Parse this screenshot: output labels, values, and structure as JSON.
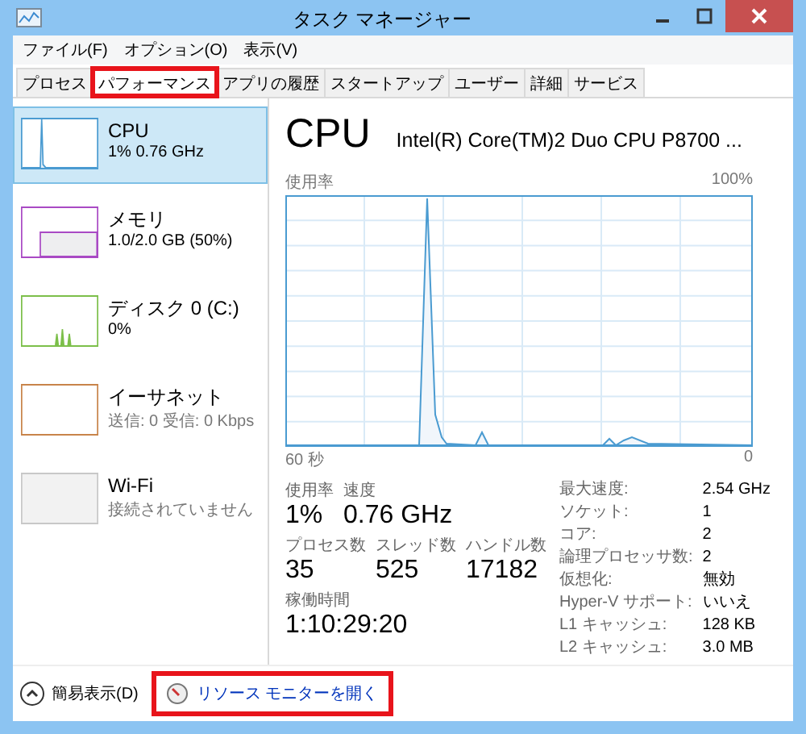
{
  "window": {
    "title": "タスク マネージャー"
  },
  "menu": [
    "ファイル(F)",
    "オプション(O)",
    "表示(V)"
  ],
  "tabs": [
    {
      "label": "プロセス",
      "selected": false,
      "highlighted": false
    },
    {
      "label": "パフォーマンス",
      "selected": true,
      "highlighted": true
    },
    {
      "label": "アプリの履歴",
      "selected": false,
      "highlighted": false
    },
    {
      "label": "スタートアップ",
      "selected": false,
      "highlighted": false
    },
    {
      "label": "ユーザー",
      "selected": false,
      "highlighted": false
    },
    {
      "label": "詳細",
      "selected": false,
      "highlighted": false
    },
    {
      "label": "サービス",
      "selected": false,
      "highlighted": false
    }
  ],
  "resources": [
    {
      "kind": "cpu",
      "name": "CPU",
      "detail": "1% 0.76 GHz",
      "selected": true,
      "color": "#4a9bd1"
    },
    {
      "kind": "memory",
      "name": "メモリ",
      "detail": "1.0/2.0 GB (50%)",
      "selected": false,
      "color": "#a94ac4"
    },
    {
      "kind": "disk",
      "name": "ディスク 0 (C:)",
      "detail": "0%",
      "selected": false,
      "color": "#7cbf4a"
    },
    {
      "kind": "ethernet",
      "name": "イーサネット",
      "detail": "送信: 0 受信: 0 Kbps",
      "selected": false,
      "color": "#c8844a"
    },
    {
      "kind": "wifi",
      "name": "Wi-Fi",
      "detail": "接続されていません",
      "selected": false,
      "color": "#c8c8c8"
    }
  ],
  "detail": {
    "title": "CPU",
    "model": "Intel(R) Core(TM)2 Duo CPU P8700 ...",
    "y_label": "使用率",
    "y_max": "100%",
    "x_start": "60 秒",
    "x_end": "0",
    "stats": [
      {
        "label": "使用率",
        "value": "1%"
      },
      {
        "label": "速度",
        "value": "0.76 GHz"
      }
    ],
    "counts": [
      {
        "label": "プロセス数",
        "value": "35"
      },
      {
        "label": "スレッド数",
        "value": "525"
      },
      {
        "label": "ハンドル数",
        "value": "17182"
      }
    ],
    "uptime": {
      "label": "稼働時間",
      "value": "1:10:29:20"
    },
    "specs": [
      {
        "label": "最大速度:",
        "value": "2.54 GHz"
      },
      {
        "label": "ソケット:",
        "value": "1"
      },
      {
        "label": "コア:",
        "value": "2"
      },
      {
        "label": "論理プロセッサ数:",
        "value": "2"
      },
      {
        "label": "仮想化:",
        "value": "無効"
      },
      {
        "label": "Hyper-V サポート:",
        "value": "いいえ"
      },
      {
        "label": "L1 キャッシュ:",
        "value": "128 KB"
      },
      {
        "label": "L2 キャッシュ:",
        "value": "3.0 MB"
      }
    ]
  },
  "footer": {
    "fewer_details": "簡易表示(D)",
    "open_monitor": "リソース モニターを開く",
    "monitor_highlighted": true
  }
}
